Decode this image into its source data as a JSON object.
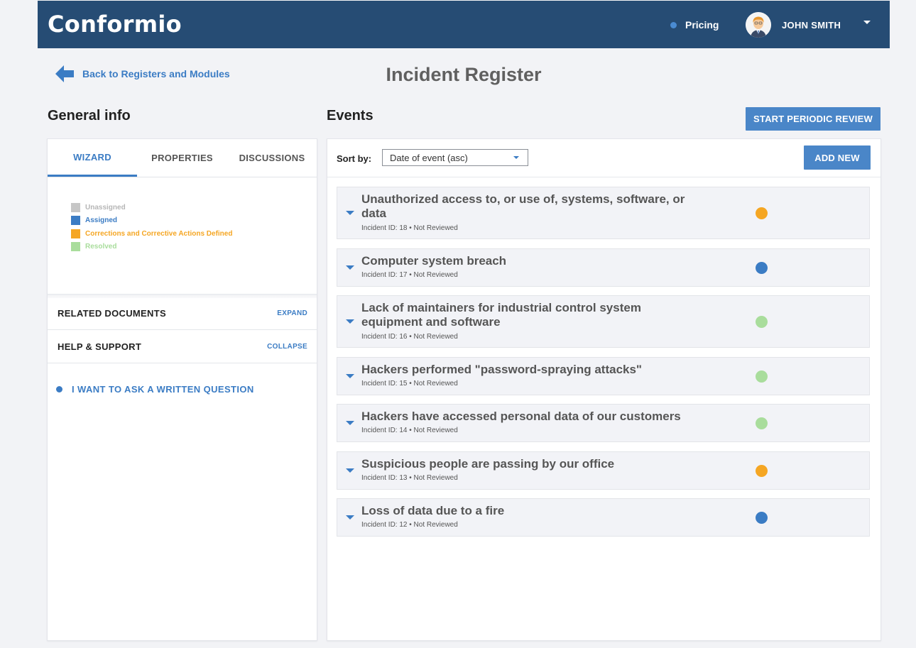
{
  "header": {
    "logo": "Conformio",
    "pricing_label": "Pricing",
    "user_name": "JOHN SMITH"
  },
  "nav": {
    "back_label": "Back to Registers and Modules"
  },
  "page": {
    "title": "Incident Register"
  },
  "general_info": {
    "title": "General info",
    "tabs": [
      {
        "label": "WIZARD",
        "active": true
      },
      {
        "label": "PROPERTIES",
        "active": false
      },
      {
        "label": "DISCUSSIONS",
        "active": false
      }
    ],
    "legend": [
      {
        "label": "Unassigned",
        "color": "#c6c6c6"
      },
      {
        "label": "Assigned",
        "color": "#3b7cc4"
      },
      {
        "label": "Corrections and Corrective Actions Defined",
        "color": "#f5a623"
      },
      {
        "label": "Resolved",
        "color": "#a9dd9c"
      }
    ],
    "related_documents": {
      "title": "RELATED DOCUMENTS",
      "action": "EXPAND"
    },
    "help_support": {
      "title": "HELP & SUPPORT",
      "action": "COLLAPSE"
    },
    "ask_question": "I WANT TO ASK A WRITTEN QUESTION"
  },
  "events": {
    "title": "Events",
    "start_review_label": "START PERIODIC REVIEW",
    "sort_label": "Sort by:",
    "sort_value": "Date of event (asc)",
    "add_new_label": "ADD NEW",
    "items": [
      {
        "title": "Unauthorized access to, or use of, systems, software, or data",
        "meta": "Incident ID: 18 • Not Reviewed",
        "status_color": "#f5a623"
      },
      {
        "title": "Computer system breach",
        "meta": "Incident ID: 17 • Not Reviewed",
        "status_color": "#3b7cc4"
      },
      {
        "title": "Lack of maintainers for industrial control system equipment and software",
        "meta": "Incident ID: 16 • Not Reviewed",
        "status_color": "#a9dd9c"
      },
      {
        "title": "Hackers performed \"password-spraying attacks\"",
        "meta": "Incident ID: 15 • Not Reviewed",
        "status_color": "#a9dd9c"
      },
      {
        "title": "Hackers have accessed personal data of our customers",
        "meta": "Incident ID: 14 • Not Reviewed",
        "status_color": "#a9dd9c"
      },
      {
        "title": "Suspicious people are passing by our office",
        "meta": "Incident ID: 13 • Not Reviewed",
        "status_color": "#f5a623"
      },
      {
        "title": "Loss of data due to a fire",
        "meta": "Incident ID: 12 • Not Reviewed",
        "status_color": "#3b7cc4"
      }
    ]
  },
  "colors": {
    "header_bg": "#264c74",
    "accent": "#3b7cc4",
    "button": "#4a86c8"
  }
}
